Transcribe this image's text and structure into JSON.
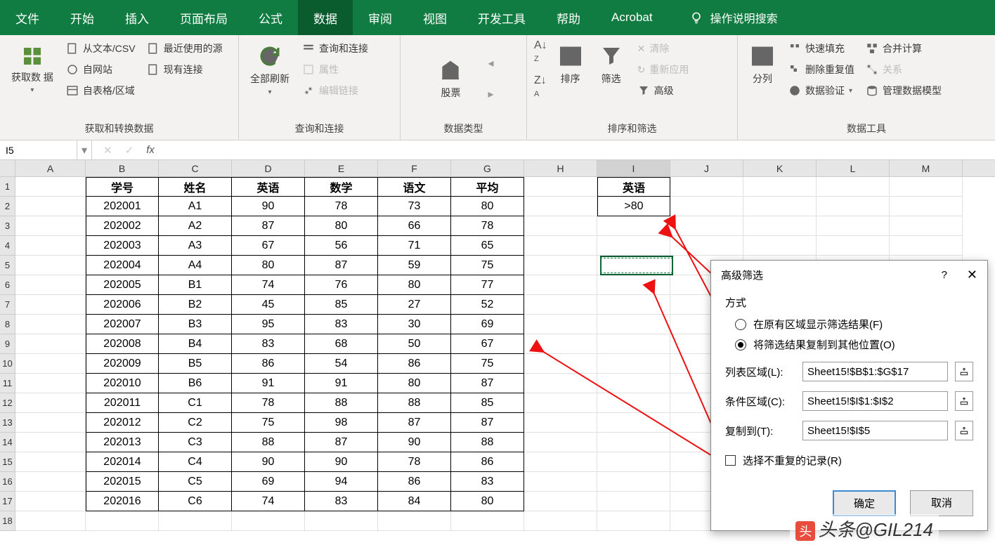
{
  "menu": {
    "items": [
      "文件",
      "开始",
      "插入",
      "页面布局",
      "公式",
      "数据",
      "审阅",
      "视图",
      "开发工具",
      "帮助",
      "Acrobat"
    ],
    "active_index": 5,
    "search_hint": "操作说明搜索"
  },
  "ribbon": {
    "groups": [
      {
        "label": "获取和转换数据",
        "big": "获取数\n据",
        "btns": [
          "从文本/CSV",
          "自网站",
          "自表格/区域",
          "最近使用的源",
          "现有连接"
        ]
      },
      {
        "label": "查询和连接",
        "big": "全部刷新",
        "btns": [
          "查询和连接",
          "属性",
          "编辑链接"
        ]
      },
      {
        "label": "数据类型",
        "big": "股票"
      },
      {
        "label": "排序和筛选",
        "sort_az": "排序",
        "filter": "筛选",
        "btns": [
          "清除",
          "重新应用",
          "高级"
        ]
      },
      {
        "label": "数据工具",
        "big": "分列",
        "btns": [
          "快速填充",
          "删除重复值",
          "数据验证",
          "合并计算",
          "关系",
          "管理数据模型"
        ]
      }
    ]
  },
  "formula_bar": {
    "name_box": "I5",
    "fx": "fx",
    "value": ""
  },
  "columns": [
    "A",
    "B",
    "C",
    "D",
    "E",
    "F",
    "G",
    "H",
    "I",
    "J",
    "K",
    "L",
    "M"
  ],
  "row_count": 18,
  "table": {
    "headers": [
      "学号",
      "姓名",
      "英语",
      "数学",
      "语文",
      "平均"
    ],
    "rows": [
      [
        "202001",
        "A1",
        "90",
        "78",
        "73",
        "80"
      ],
      [
        "202002",
        "A2",
        "87",
        "80",
        "66",
        "78"
      ],
      [
        "202003",
        "A3",
        "67",
        "56",
        "71",
        "65"
      ],
      [
        "202004",
        "A4",
        "80",
        "87",
        "59",
        "75"
      ],
      [
        "202005",
        "B1",
        "74",
        "76",
        "80",
        "77"
      ],
      [
        "202006",
        "B2",
        "45",
        "85",
        "27",
        "52"
      ],
      [
        "202007",
        "B3",
        "95",
        "83",
        "30",
        "69"
      ],
      [
        "202008",
        "B4",
        "83",
        "68",
        "50",
        "67"
      ],
      [
        "202009",
        "B5",
        "86",
        "54",
        "86",
        "75"
      ],
      [
        "202010",
        "B6",
        "91",
        "91",
        "80",
        "87"
      ],
      [
        "202011",
        "C1",
        "78",
        "88",
        "88",
        "85"
      ],
      [
        "202012",
        "C2",
        "75",
        "98",
        "87",
        "87"
      ],
      [
        "202013",
        "C3",
        "88",
        "87",
        "90",
        "88"
      ],
      [
        "202014",
        "C4",
        "90",
        "90",
        "78",
        "86"
      ],
      [
        "202015",
        "C5",
        "69",
        "94",
        "86",
        "83"
      ],
      [
        "202016",
        "C6",
        "74",
        "83",
        "84",
        "80"
      ]
    ]
  },
  "criteria": {
    "header": "英语",
    "value": ">80"
  },
  "dialog": {
    "title": "高级筛选",
    "help": "?",
    "mode_label": "方式",
    "radio1": "在原有区域显示筛选结果(F)",
    "radio2": "将筛选结果复制到其他位置(O)",
    "list_label": "列表区域(L):",
    "list_value": "Sheet15!$B$1:$G$17",
    "crit_label": "条件区域(C):",
    "crit_value": "Sheet15!$I$1:$I$2",
    "copy_label": "复制到(T):",
    "copy_value": "Sheet15!$I$5",
    "unique_label": "选择不重复的记录(R)",
    "ok": "确定",
    "cancel": "取消"
  },
  "watermark": "头条@GIL214"
}
